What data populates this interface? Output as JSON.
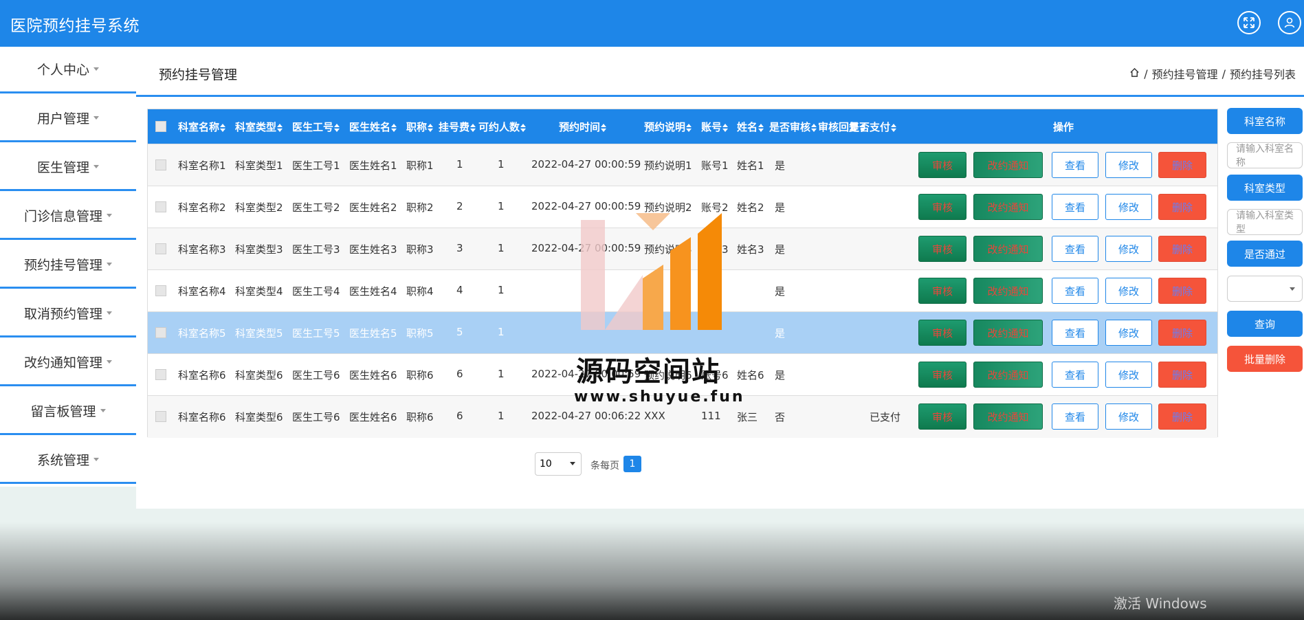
{
  "app": {
    "title": "医院预约挂号系统"
  },
  "sidebar": {
    "items": [
      {
        "label": "个人中心"
      },
      {
        "label": "用户管理"
      },
      {
        "label": "医生管理"
      },
      {
        "label": "门诊信息管理"
      },
      {
        "label": "预约挂号管理"
      },
      {
        "label": "取消预约管理"
      },
      {
        "label": "改约通知管理"
      },
      {
        "label": "留言板管理"
      },
      {
        "label": "系统管理"
      }
    ]
  },
  "page": {
    "title": "预约挂号管理",
    "breadcrumb": [
      "预约挂号管理",
      "预约挂号列表"
    ]
  },
  "table": {
    "columns": [
      "科室名称",
      "科室类型",
      "医生工号",
      "医生姓名",
      "职称",
      "挂号费",
      "可约人数",
      "预约时间",
      "预约说明",
      "账号",
      "姓名",
      "是否审核",
      "审核回复",
      "是否支付",
      "操作"
    ],
    "rows": [
      {
        "dept": "科室名称1",
        "type": "科室类型1",
        "doc_id": "医生工号1",
        "doc_name": "医生姓名1",
        "title": "职称1",
        "fee": "1",
        "slots": "1",
        "time": "2022-04-27 00:00:59",
        "note": "预约说明1",
        "account": "账号1",
        "name": "姓名1",
        "audited": "是",
        "reply": "",
        "paid": ""
      },
      {
        "dept": "科室名称2",
        "type": "科室类型2",
        "doc_id": "医生工号2",
        "doc_name": "医生姓名2",
        "title": "职称2",
        "fee": "2",
        "slots": "1",
        "time": "2022-04-27 00:00:59",
        "note": "预约说明2",
        "account": "账号2",
        "name": "姓名2",
        "audited": "是",
        "reply": "",
        "paid": ""
      },
      {
        "dept": "科室名称3",
        "type": "科室类型3",
        "doc_id": "医生工号3",
        "doc_name": "医生姓名3",
        "title": "职称3",
        "fee": "3",
        "slots": "1",
        "time": "2022-04-27 00:00:59",
        "note": "预约说明3",
        "account": "账号3",
        "name": "姓名3",
        "audited": "是",
        "reply": "",
        "paid": ""
      },
      {
        "dept": "科室名称4",
        "type": "科室类型4",
        "doc_id": "医生工号4",
        "doc_name": "医生姓名4",
        "title": "职称4",
        "fee": "4",
        "slots": "1",
        "time": "",
        "note": "",
        "account": "",
        "name": "",
        "audited": "是",
        "reply": "",
        "paid": ""
      },
      {
        "dept": "科室名称5",
        "type": "科室类型5",
        "doc_id": "医生工号5",
        "doc_name": "医生姓名5",
        "title": "职称5",
        "fee": "5",
        "slots": "1",
        "time": "",
        "note": "",
        "account": "",
        "name": "",
        "audited": "是",
        "reply": "",
        "paid": ""
      },
      {
        "dept": "科室名称6",
        "type": "科室类型6",
        "doc_id": "医生工号6",
        "doc_name": "医生姓名6",
        "title": "职称6",
        "fee": "6",
        "slots": "1",
        "time": "2022-04-27 00:00:59",
        "note": "预约说明6",
        "account": "账号6",
        "name": "姓名6",
        "audited": "是",
        "reply": "",
        "paid": ""
      },
      {
        "dept": "科室名称6",
        "type": "科室类型6",
        "doc_id": "医生工号6",
        "doc_name": "医生姓名6",
        "title": "职称6",
        "fee": "6",
        "slots": "1",
        "time": "2022-04-27 00:06:22",
        "note": "XXX",
        "account": "111",
        "name": "张三",
        "audited": "否",
        "reply": "",
        "paid": "已支付"
      }
    ],
    "actions": {
      "audit": "审核",
      "notice": "改约通知",
      "view": "查看",
      "edit": "修改",
      "delete": "删除"
    }
  },
  "search": {
    "dept_label": "科室名称",
    "dept_placeholder": "请输入科室名称",
    "type_label": "科室类型",
    "type_placeholder": "请输入科室类型",
    "pass_label": "是否通过",
    "query_button": "查询",
    "batch_delete_button": "批量删除"
  },
  "pagination": {
    "page_size": "10",
    "per_page_label": "条每页",
    "current_page": "1"
  },
  "watermark": {
    "title": "源码空间站",
    "url": "www.shuyue.fun"
  },
  "os_overlay": {
    "activate": "激活 Windows"
  },
  "colors": {
    "primary": "#1e86e8",
    "danger": "#f5543a",
    "success": "#17885f"
  }
}
